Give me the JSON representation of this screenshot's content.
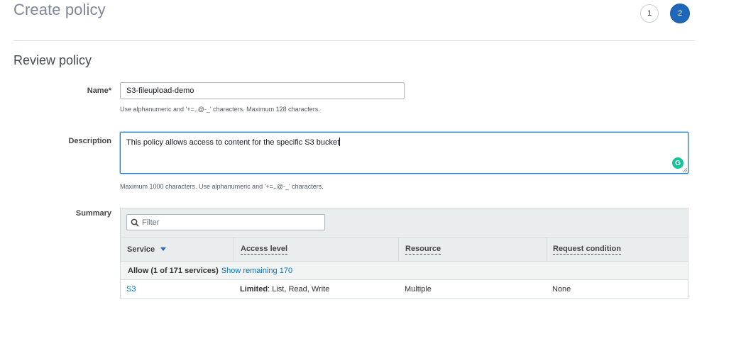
{
  "header": {
    "title": "Create policy",
    "steps": [
      "1",
      "2"
    ],
    "active_step": 2
  },
  "review": {
    "section_title": "Review policy",
    "name_label": "Name*",
    "name_value": "S3-fileupload-demo",
    "name_hint": "Use alphanumeric and '+=,.@-_' characters. Maximum 128 characters.",
    "description_label": "Description",
    "description_value": "This policy allows access  to content for the specific S3 bucket",
    "description_hint": "Maximum 1000 characters. Use alphanumeric and '+=,.@-_' characters.",
    "summary_label": "Summary"
  },
  "summary_table": {
    "filter_placeholder": "Filter",
    "columns": [
      "Service",
      "Access level",
      "Resource",
      "Request condition"
    ],
    "group_label": "Allow (1 of 171 services)",
    "group_link": "Show remaining 170",
    "rows": [
      {
        "service": "S3",
        "access_bold": "Limited",
        "access_rest": ": List, Read, Write",
        "resource": "Multiple",
        "condition": "None"
      }
    ]
  },
  "colors": {
    "accent": "#1f67b9",
    "link": "#0073bb",
    "grammarly": "#15c39a"
  },
  "icons": [
    "search-icon",
    "sort-down-icon",
    "grammarly-icon"
  ]
}
